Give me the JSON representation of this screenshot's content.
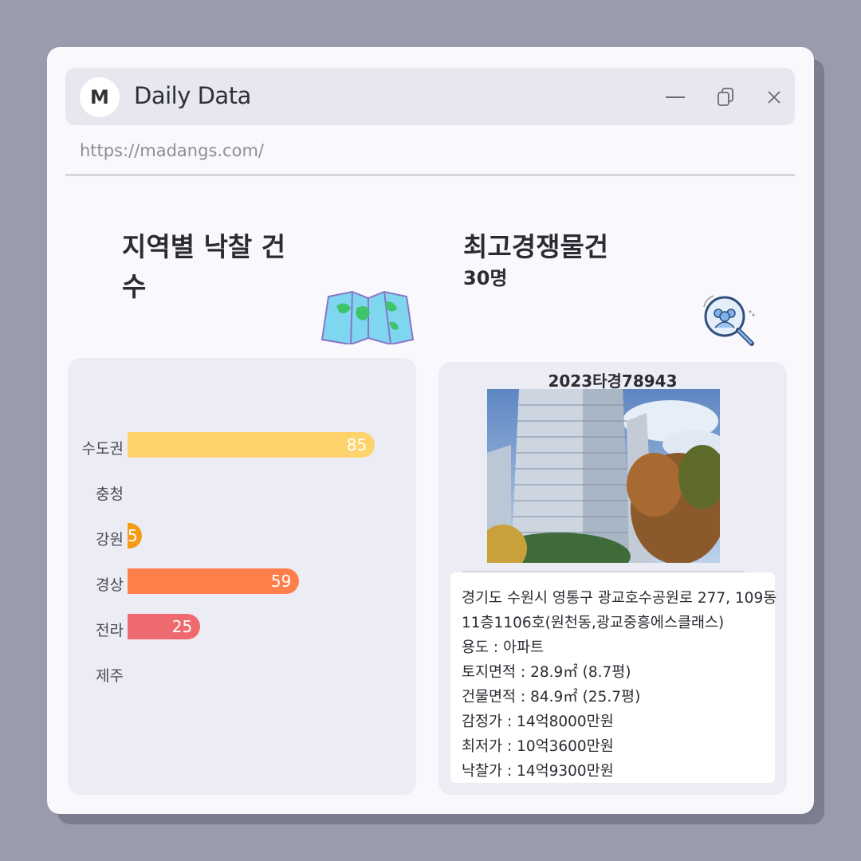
{
  "window": {
    "logo_letter": "M",
    "title": "Daily Data",
    "url": "https://madangs.com/"
  },
  "left": {
    "heading": "지역별 낙찰 건수",
    "icon": "map-icon"
  },
  "right": {
    "heading": "최고경쟁물건",
    "subheading": "30명",
    "icon": "search-people-icon",
    "case_number": "2023타경78943",
    "info": [
      "경기도 수원시 영통구 광교호수공원로 277, 109동",
      "11층1106호(원천동,광교중흥에스클래스)",
      "용도 : 아파트",
      "토지면적 : 28.9㎡ (8.7평)",
      "건물면적 : 84.9㎡ (25.7평)",
      "감정가 : 14억8000만원",
      "최저가 : 10억3600만원",
      "낙찰가 : 14억9300만원"
    ]
  },
  "chart_data": {
    "type": "bar",
    "orientation": "horizontal",
    "categories": [
      "수도권",
      "충청",
      "강원",
      "경상",
      "전라",
      "제주"
    ],
    "values": [
      85,
      0,
      5,
      59,
      25,
      0
    ],
    "value_labels": [
      "85",
      "",
      "5",
      "59",
      "25",
      ""
    ],
    "colors": [
      "#ffd36b",
      "#ffd36b",
      "#f59a14",
      "#ff7f4a",
      "#ef6a6e",
      "#ef6a6e"
    ],
    "xlim": [
      0,
      100
    ]
  }
}
